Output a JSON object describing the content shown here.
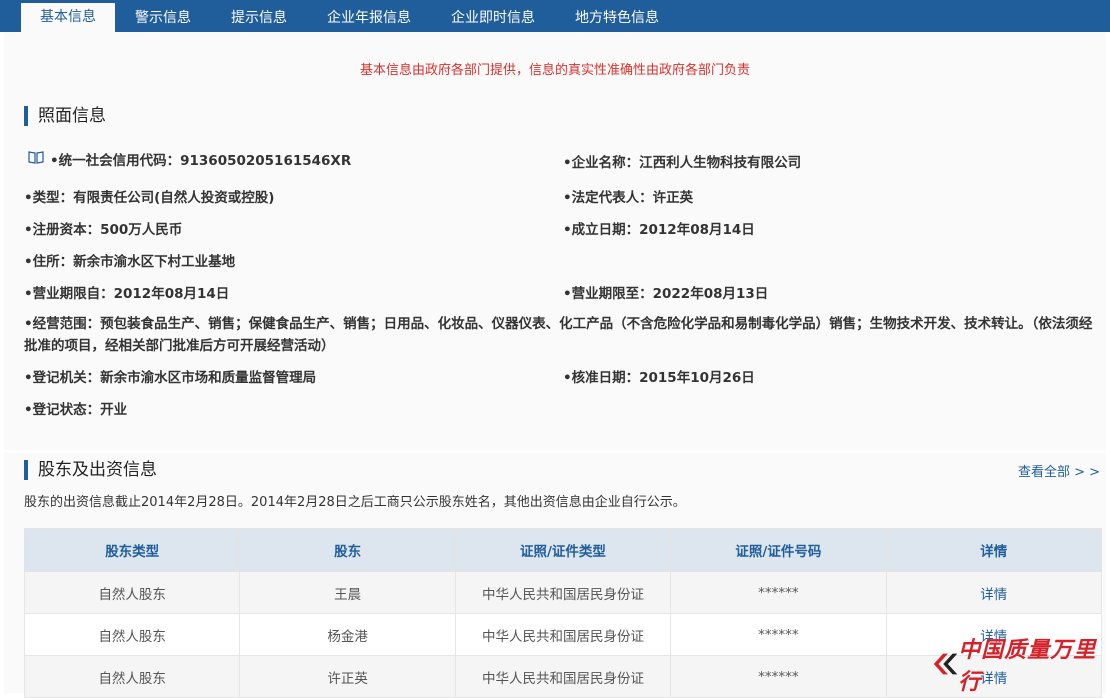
{
  "tabs": [
    {
      "label": "基本信息",
      "active": true
    },
    {
      "label": "警示信息"
    },
    {
      "label": "提示信息"
    },
    {
      "label": "企业年报信息"
    },
    {
      "label": "企业即时信息"
    },
    {
      "label": "地方特色信息"
    }
  ],
  "notice": "基本信息由政府各部门提供，信息的真实性准确性由政府各部门负责",
  "license": {
    "title": "照面信息",
    "credit_code": "•统一社会信用代码：9136050205161546XR",
    "company_name": "•企业名称：江西利人生物科技有限公司",
    "type": "•类型：有限责任公司(自然人投资或控股)",
    "legal_rep": "•法定代表人：许正英",
    "capital": "•注册资本：500万人民币",
    "founded": "•成立日期：2012年08月14日",
    "address": "•住所：新余市渝水区下村工业基地",
    "term_from": "•营业期限自：2012年08月14日",
    "term_to": "•营业期限至：2022年08月13日",
    "scope": "•经营范围：预包装食品生产、销售；保健食品生产、销售；日用品、化妆品、仪器仪表、化工产品（不含危险化学品和易制毒化学品）销售；生物技术开发、技术转让。（依法须经批准的项目，经相关部门批准后方可开展经营活动）",
    "authority": "•登记机关：新余市渝水区市场和质量监督管理局",
    "approved": "•核准日期：2015年10月26日",
    "status": "•登记状态：开业"
  },
  "shareholders": {
    "title": "股东及出资信息",
    "view_all": "查看全部 > >",
    "note": "股东的出资信息截止2014年2月28日。2014年2月28日之后工商只公示股东姓名，其他出资信息由企业自行公示。",
    "columns": [
      "股东类型",
      "股东",
      "证照/证件类型",
      "证照/证件号码",
      "详情"
    ],
    "rows": [
      [
        "自然人股东",
        "王晨",
        "中华人民共和国居民身份证",
        "******",
        "详情"
      ],
      [
        "自然人股东",
        "杨金港",
        "中华人民共和国居民身份证",
        "******",
        "详情"
      ],
      [
        "自然人股东",
        "许正英",
        "中华人民共和国居民身份证",
        "******",
        "详情"
      ]
    ]
  },
  "watermark": "中国质量万里行",
  "colors": {
    "header": "#1f5d9b",
    "notice": "#d8322e",
    "logo": "#d5222a"
  },
  "icons": {
    "credit_code": "book-icon",
    "logo": "chevron-logo-icon"
  }
}
